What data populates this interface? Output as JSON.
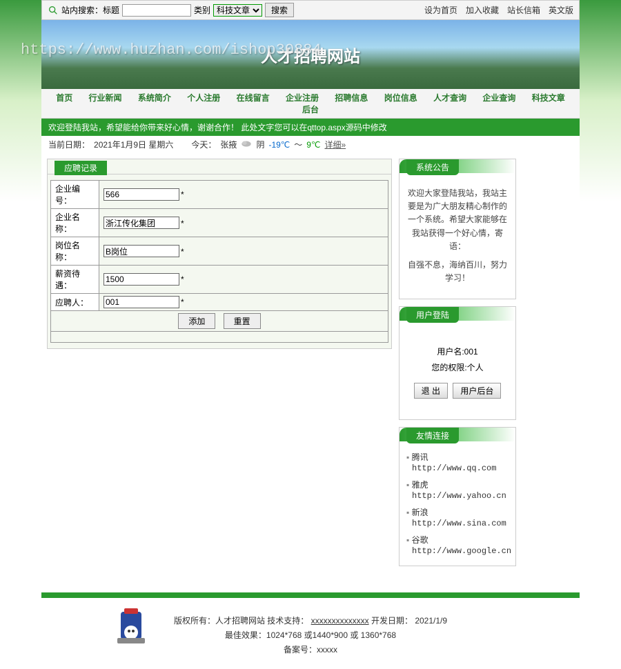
{
  "watermark": "https://www.huzhan.com/ishop30884",
  "topbar": {
    "search_label": "站内搜索：标题",
    "category_label": "类别",
    "category_value": "科技文章",
    "search_btn": "搜索",
    "links": [
      "设为首页",
      "加入收藏",
      "站长信箱",
      "英文版"
    ]
  },
  "banner": {
    "title": "人才招聘网站"
  },
  "nav": [
    "首页",
    "行业新闻",
    "系统简介",
    "个人注册",
    "在线留言",
    "企业注册",
    "招聘信息",
    "岗位信息",
    "人才查询",
    "企业查询",
    "科技文章",
    "后台"
  ],
  "welcome": "欢迎登陆我站，希望能给你带来好心情，谢谢合作！ 此处文字您可以在qttop.aspx源码中修改",
  "datebar": {
    "prefix": "当前日期：",
    "date": "2021年1月9日  星期六",
    "today_label": "今天：",
    "city": "张掖",
    "weather": "阴",
    "temp_low": "-19℃",
    "temp_sep": "～",
    "temp_high": "9℃",
    "detail": "详细»"
  },
  "form": {
    "title": "应聘记录",
    "rows": [
      {
        "label": "企业编号：",
        "value": "566"
      },
      {
        "label": "企业名称：",
        "value": "浙江传化集团"
      },
      {
        "label": "岗位名称：",
        "value": "B岗位"
      },
      {
        "label": "薪资待遇：",
        "value": "1500"
      },
      {
        "label": "应聘人：",
        "value": "001"
      }
    ],
    "req": "*",
    "add_btn": "添加",
    "reset_btn": "重置"
  },
  "notice": {
    "title": "系统公告",
    "body": "欢迎大家登陆我站，我站主要是为广大朋友精心制作的一个系统。希望大家能够在我站获得一个好心情，寄语：",
    "body2": "自强不息，海纳百川，努力学习！"
  },
  "login": {
    "title": "用户登陆",
    "user_label": "用户名:",
    "user_value": "001",
    "perm_label": "您的权限:",
    "perm_value": "个人",
    "logout_btn": "退 出",
    "backend_btn": "用户后台"
  },
  "links": {
    "title": "友情连接",
    "items": [
      {
        "name": "腾讯",
        "url": "http://www.qq.com"
      },
      {
        "name": "雅虎",
        "url": "http://www.yahoo.cn"
      },
      {
        "name": "新浪",
        "url": "http://www.sina.com"
      },
      {
        "name": "谷歌",
        "url": "http://www.google.cn"
      }
    ]
  },
  "footer": {
    "line1_a": "版权所有：人才招聘网站 技术支持：",
    "line1_b": "xxxxxxxxxxxxxx",
    "line1_c": " 开发日期：  2021/1/9",
    "line2": "最佳效果：1024*768 或1440*900 或 1360*768",
    "line3": "备案号：xxxxx"
  }
}
